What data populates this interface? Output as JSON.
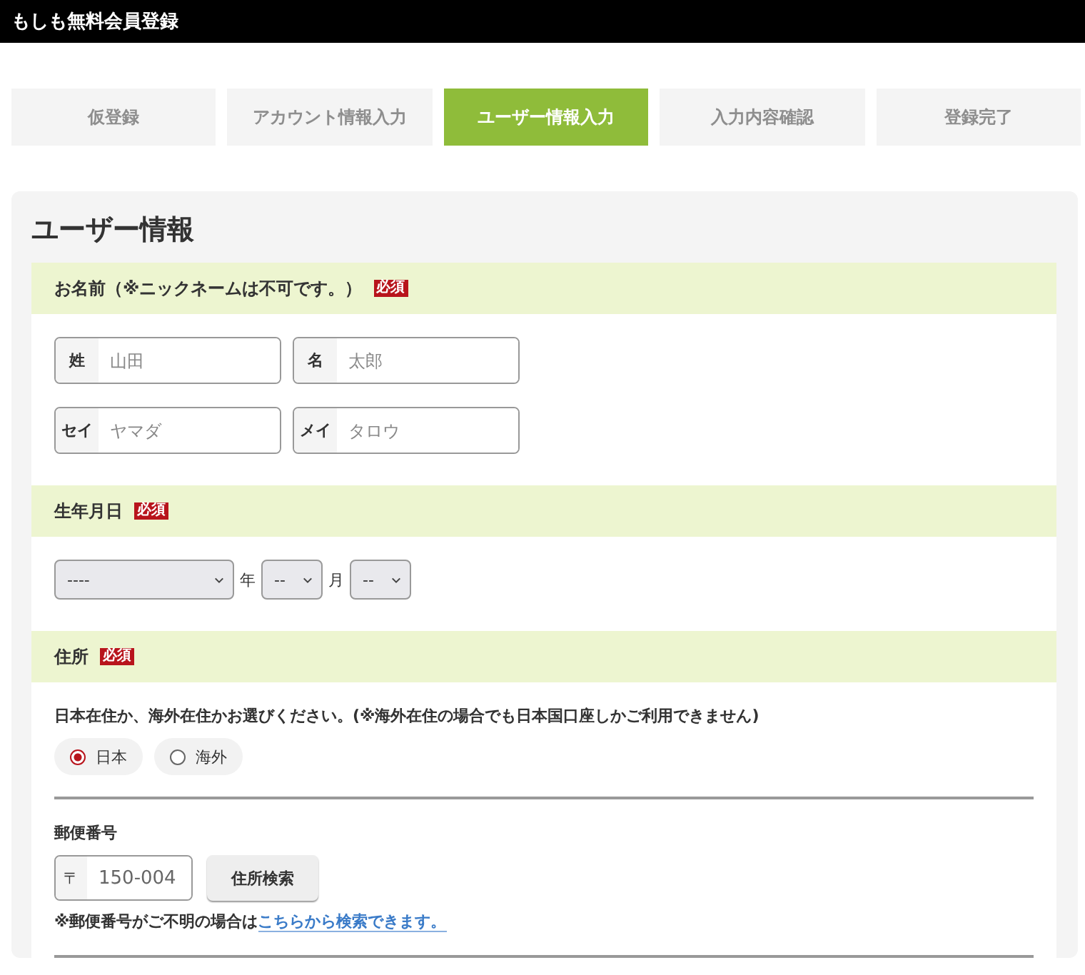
{
  "header": {
    "title": "もしも無料会員登録"
  },
  "steps": [
    {
      "label": "仮登録",
      "selected": false
    },
    {
      "label": "アカウント情報入力",
      "selected": false
    },
    {
      "label": "ユーザー情報入力",
      "selected": true
    },
    {
      "label": "入力内容確認",
      "selected": false
    },
    {
      "label": "登録完了",
      "selected": false
    }
  ],
  "form": {
    "title": "ユーザー情報",
    "name_section": {
      "label": "お名前（※ニックネームは不可です。）",
      "required_badge": "必須",
      "fields": [
        {
          "prefix": "姓",
          "placeholder": "山田"
        },
        {
          "prefix": "名",
          "placeholder": "太郎"
        },
        {
          "prefix": "セイ",
          "placeholder": "ヤマダ"
        },
        {
          "prefix": "メイ",
          "placeholder": "タロウ"
        }
      ]
    },
    "birth_section": {
      "label": "生年月日",
      "required_badge": "必須",
      "selects": [
        {
          "value": "----",
          "unit": "年"
        },
        {
          "value": "--",
          "unit": "月"
        },
        {
          "value": "--"
        }
      ]
    },
    "address_section": {
      "label": "住所",
      "required_badge": "必須",
      "residence_prompt": "日本在住か、海外在住かお選びください。(※海外在住の場合でも日本国口座しかご利用できません)",
      "residence_options": [
        {
          "label": "日本",
          "selected": true
        },
        {
          "label": "海外",
          "selected": false
        }
      ],
      "postal_label": "郵便番号",
      "postal_prefix": "〒",
      "postal_value": "150-004",
      "search_button": "住所検索",
      "postal_note": "※郵便番号がご不明の場合は",
      "postal_link": "こちらから検索できます。"
    }
  }
}
